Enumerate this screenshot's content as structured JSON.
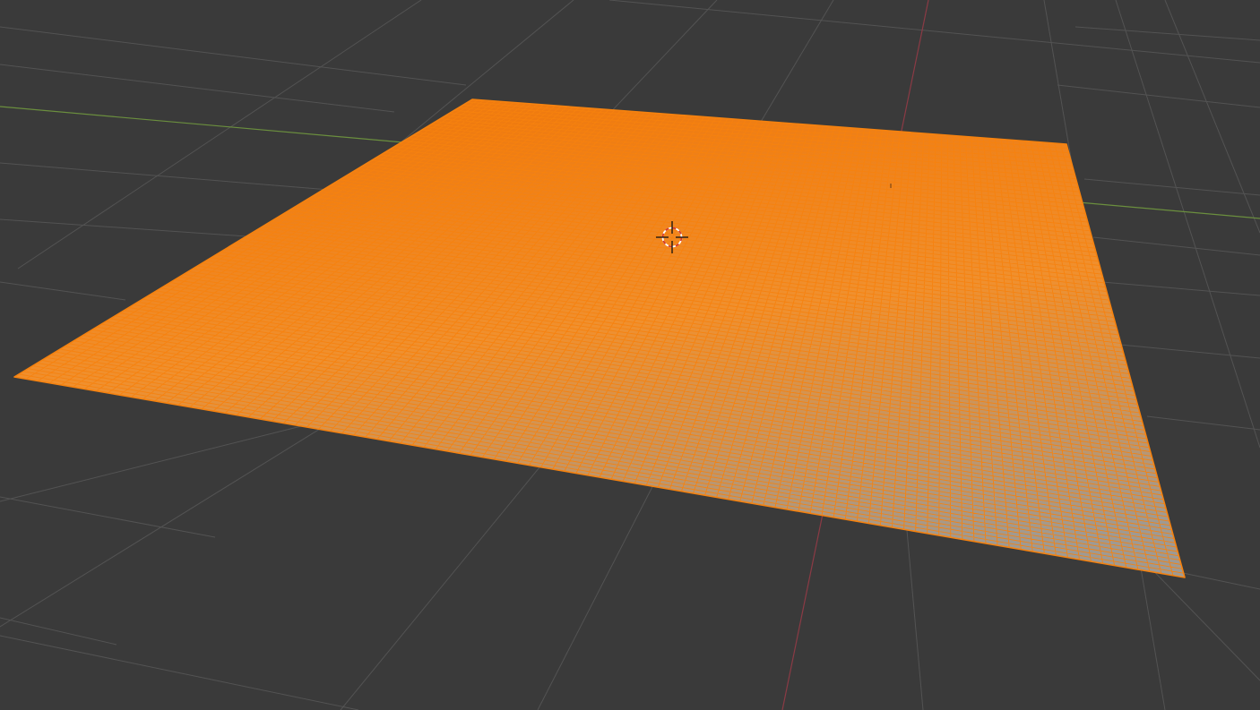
{
  "viewport": {
    "corner_text": "",
    "background_color": "#3a3a3a",
    "grid_line_color": "#535353",
    "x_axis_color": "#8b3a45",
    "y_axis_color": "#6b8f3e"
  },
  "mesh": {
    "object_type": "plane",
    "state": "selected",
    "edit_mode": true,
    "selection_color": "#f5820f",
    "face_color_far": "#ef7b10",
    "face_color_near": "#9e9a94"
  },
  "icons": {
    "cursor": "3d-cursor-icon"
  }
}
